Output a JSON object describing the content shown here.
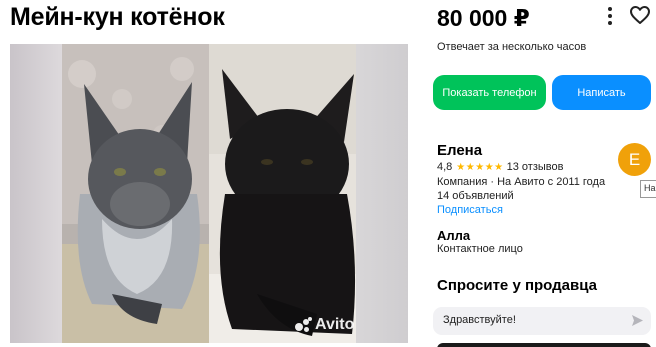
{
  "listing": {
    "title": "Мейн-кун котёнок",
    "price": "80 000 ₽",
    "response_time": "Отвечает за несколько часов"
  },
  "photo": {
    "watermark": "Avito"
  },
  "buttons": {
    "show_phone": "Показать телефон",
    "write": "Написать"
  },
  "seller": {
    "name": "Елена",
    "rating": "4,8",
    "rating_value": 4.8,
    "reviews": "13 отзывов",
    "company_info": "Компания · На Авито с 2011 года",
    "ads_count": "14 объявлений",
    "subscribe": "Подписаться",
    "avatar_letter": "E",
    "avatar_color": "#f0a10a",
    "tooltip": "На"
  },
  "contact": {
    "name": "Алла",
    "role": "Контактное лицо"
  },
  "ask": {
    "title": "Спросите у продавца",
    "message": "Здравствуйте!"
  },
  "colors": {
    "green": "#00c35a",
    "blue": "#0a8fff",
    "star": "#ffb800"
  },
  "icons": [
    "more-icon",
    "heart-icon",
    "star-icon",
    "send-icon"
  ]
}
